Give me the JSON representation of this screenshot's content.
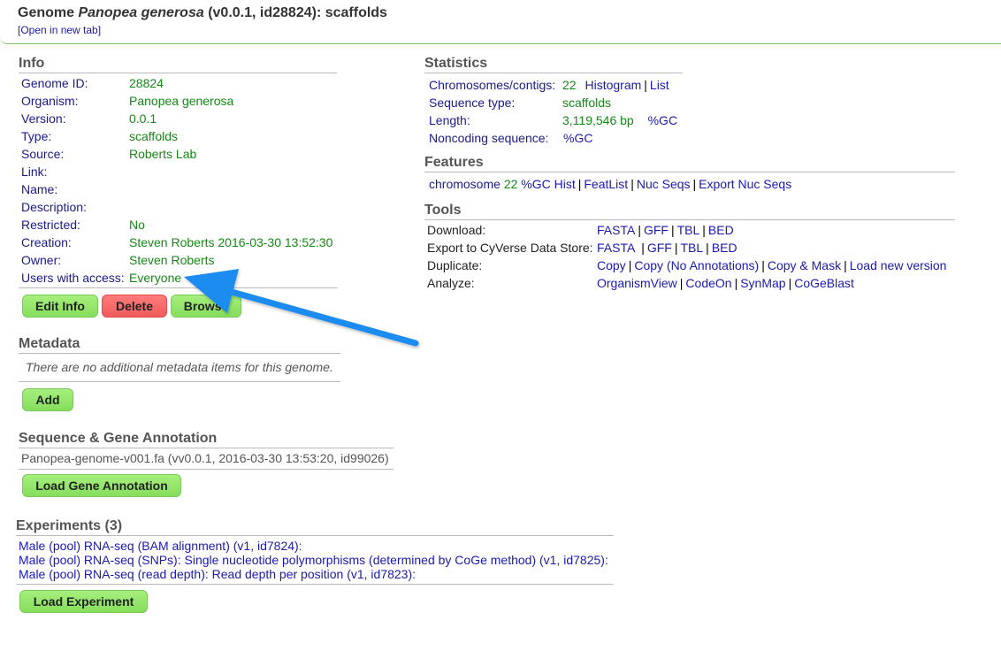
{
  "header": {
    "title_prefix": "Genome ",
    "title_organism": "Panopea generosa",
    "title_suffix": " (v0.0.1, id28824): scaffolds",
    "open_link": "[Open in new tab]"
  },
  "info": {
    "title": "Info",
    "rows": [
      {
        "label": "Genome ID:",
        "value": "28824"
      },
      {
        "label": "Organism:",
        "value": "Panopea generosa"
      },
      {
        "label": "Version:",
        "value": "0.0.1"
      },
      {
        "label": "Type:",
        "value": "scaffolds"
      },
      {
        "label": "Source:",
        "value": "Roberts Lab"
      },
      {
        "label": "Link:",
        "value": ""
      },
      {
        "label": "Name:",
        "value": ""
      },
      {
        "label": "Description:",
        "value": ""
      },
      {
        "label": "Restricted:",
        "value": "No"
      },
      {
        "label": "Creation:",
        "value": "Steven Roberts 2016-03-30 13:52:30"
      },
      {
        "label": "Owner:",
        "value": "Steven Roberts"
      },
      {
        "label": "Users with access:",
        "value": "Everyone"
      }
    ],
    "buttons": {
      "edit": "Edit Info",
      "delete": "Delete",
      "browse": "Browse"
    }
  },
  "metadata": {
    "title": "Metadata",
    "empty_text": "There are no additional metadata items for this genome.",
    "add_button": "Add"
  },
  "annotation": {
    "title": "Sequence & Gene Annotation",
    "file": "Panopea-genome-v001.fa (vv0.0.1, 2016-03-30 13:53:20, id99026)",
    "load_button": "Load Gene Annotation"
  },
  "experiments": {
    "title": "Experiments (3)",
    "items": [
      "Male (pool) RNA-seq (BAM alignment) (v1, id7824):",
      "Male (pool) RNA-seq (SNPs): Single nucleotide polymorphisms (determined by CoGe method) (v1, id7825):",
      "Male (pool) RNA-seq (read depth): Read depth per position (v1, id7823):"
    ],
    "load_button": "Load Experiment"
  },
  "statistics": {
    "title": "Statistics",
    "chromosomes_label": "Chromosomes/contigs:",
    "chromosomes_value": "22",
    "histogram": "Histogram",
    "list": "List",
    "seqtype_label": "Sequence type:",
    "seqtype_value": "scaffolds",
    "length_label": "Length:",
    "length_value": "3,119,546 bp",
    "gc": "%GC",
    "noncoding_label": "Noncoding sequence:",
    "noncoding_gc": "%GC"
  },
  "features": {
    "title": "Features",
    "name": "chromosome",
    "count": "22",
    "gc_hist": "%GC Hist",
    "featlist": "FeatList",
    "nucseqs": "Nuc Seqs",
    "export": "Export Nuc Seqs"
  },
  "tools": {
    "title": "Tools",
    "download_label": "Download:",
    "cyverse_label": "Export to CyVerse Data Store:",
    "duplicate_label": "Duplicate:",
    "analyze_label": "Analyze:",
    "formats": [
      "FASTA",
      "GFF",
      "TBL",
      "BED"
    ],
    "duplicate": [
      "Copy",
      "Copy (No Annotations)",
      "Copy & Mask",
      "Load new version"
    ],
    "analyze": [
      "OrganismView",
      "CodeOn",
      "SynMap",
      "CoGeBlast"
    ]
  },
  "colors": {
    "link": "#1a1ab0",
    "value_green": "#138a13",
    "button_green": "#8fe266",
    "button_red": "#f26a6a",
    "arrow_blue": "#1e8cf0"
  }
}
